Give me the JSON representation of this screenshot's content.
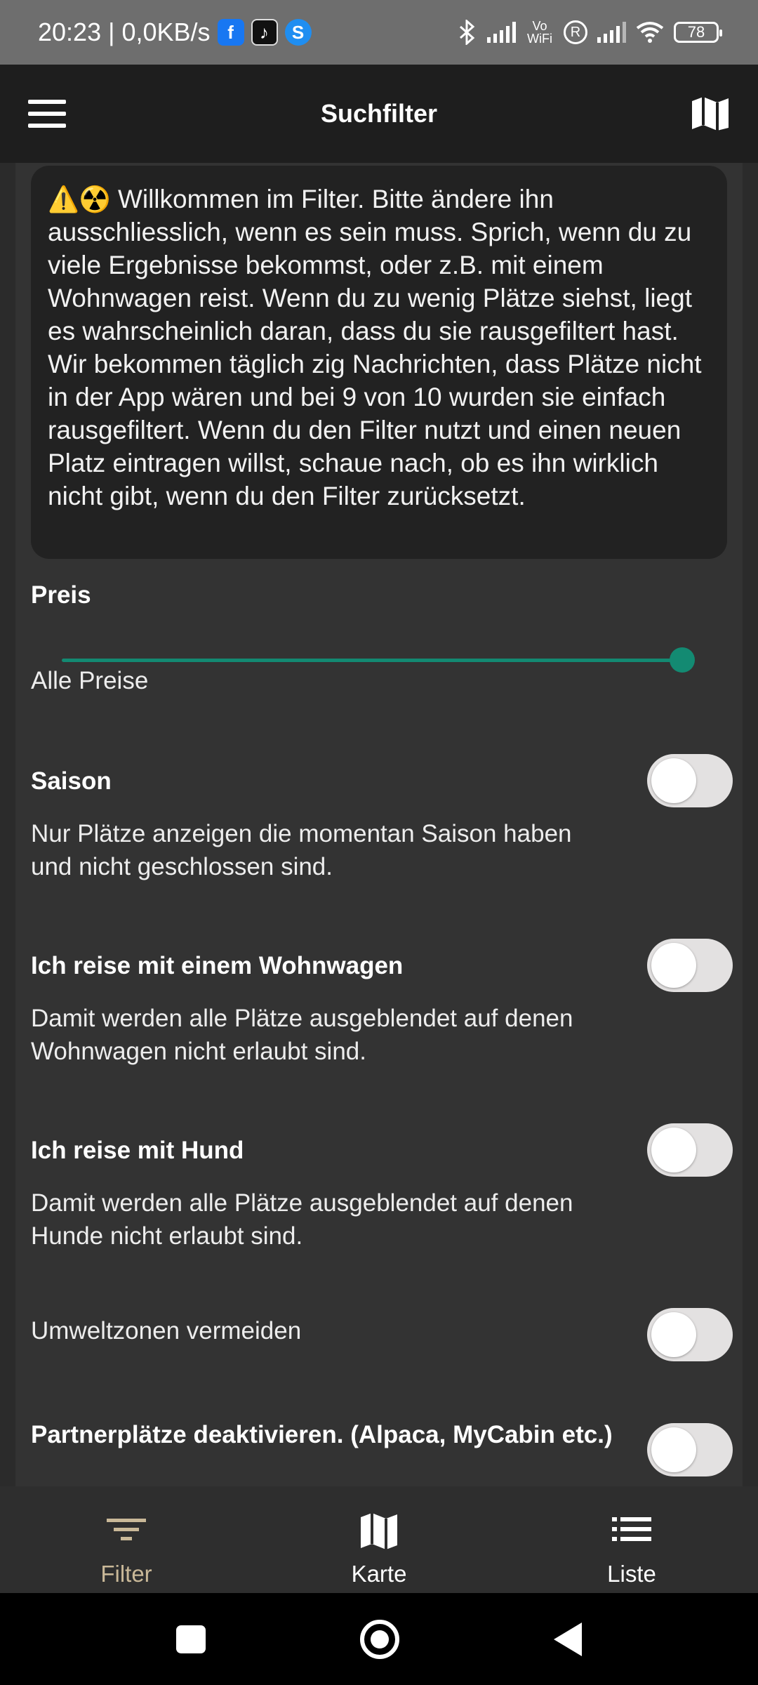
{
  "status_bar": {
    "time": "20:23",
    "separator": "|",
    "network_speed": "0,0KB/s",
    "notification_icons": [
      "facebook-icon",
      "tiktok-icon",
      "shazam-icon"
    ],
    "indicators": [
      "bluetooth-icon",
      "signal-icon",
      "vowifi-icon",
      "roaming-icon",
      "signal-icon",
      "wifi-icon"
    ],
    "vowifi_label": "Vo WiFi",
    "roaming_label": "R",
    "battery": "78"
  },
  "app_bar": {
    "title": "Suchfilter",
    "left_icon": "hamburger-menu-icon",
    "right_icon": "map-icon"
  },
  "notice": {
    "emoji": "⚠️☢️",
    "text": "Willkommen im Filter. Bitte ändere ihn ausschliesslich, wenn es sein muss. Sprich, wenn du zu viele Ergebnisse bekommst, oder z.B. mit einem Wohnwagen reist. Wenn du zu wenig Plätze siehst, liegt es wahrscheinlich daran, dass du sie rausgefiltert hast. Wir bekommen täglich zig Nachrichten, dass Plätze nicht in der App wären und bei 9 von 10 wurden sie einfach rausgefiltert. Wenn du den Filter nutzt und einen neuen Platz eintragen willst, schaue nach, ob es ihn wirklich nicht gibt, wenn du den Filter zurücksetzt."
  },
  "price": {
    "title": "Preis",
    "value_label": "Alle Preise",
    "slider_value": 1.0,
    "accent_color": "#138a72"
  },
  "filters": [
    {
      "title": "Saison",
      "description": "Nur Plätze anzeigen die momentan Saison haben und nicht geschlossen sind.",
      "enabled": false
    },
    {
      "title": "Ich reise mit einem Wohnwagen",
      "description": "Damit werden alle Plätze ausgeblendet auf denen Wohnwagen nicht erlaubt sind.",
      "enabled": false
    },
    {
      "title": "Ich reise mit Hund",
      "description": "Damit werden alle Plätze ausgeblendet auf denen Hunde nicht erlaubt sind.",
      "enabled": false
    },
    {
      "title": "Umweltzonen vermeiden",
      "enabled": false
    },
    {
      "title": "Partnerplätze deaktivieren. (Alpaca, MyCabin etc.)",
      "enabled": false
    }
  ],
  "bottom_nav": {
    "items": [
      {
        "label": "Filter",
        "icon": "filter-icon",
        "active": true
      },
      {
        "label": "Karte",
        "icon": "map-icon",
        "active": false
      },
      {
        "label": "Liste",
        "icon": "list-icon",
        "active": false
      }
    ],
    "active_color": "#c9b898"
  },
  "system_nav": {
    "buttons": [
      "recents-button",
      "home-button",
      "back-button"
    ]
  }
}
